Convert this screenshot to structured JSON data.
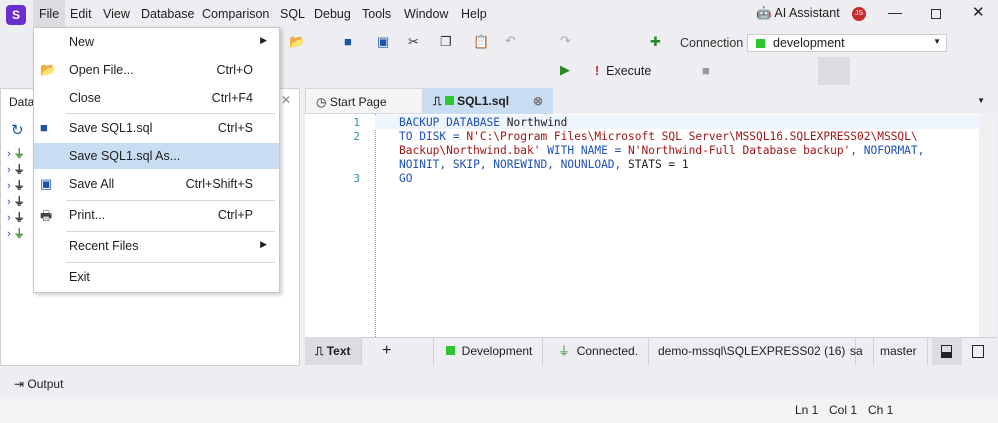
{
  "menubar": {
    "items": [
      "File",
      "Edit",
      "View",
      "Database",
      "Comparison",
      "SQL",
      "Debug",
      "Tools",
      "Window",
      "Help"
    ],
    "ai_assistant": "AI Assistant",
    "avatar": "JS"
  },
  "toolbar": {
    "connection_label": "Connection",
    "connection_value": "development",
    "execute": "Execute"
  },
  "file_menu": {
    "items": [
      {
        "label": "New",
        "shortcut": "",
        "icon": "",
        "submenu": true
      },
      {
        "label": "Open File...",
        "shortcut": "Ctrl+O",
        "icon": "open-folder-icon"
      },
      {
        "label": "Close",
        "shortcut": "Ctrl+F4",
        "icon": ""
      },
      {
        "label": "Save SQL1.sql",
        "shortcut": "Ctrl+S",
        "icon": "save-icon"
      },
      {
        "label": "Save SQL1.sql As...",
        "shortcut": "",
        "icon": "",
        "highlighted": true
      },
      {
        "label": "Save All",
        "shortcut": "Ctrl+Shift+S",
        "icon": "save-all-icon"
      },
      {
        "label": "Print...",
        "shortcut": "Ctrl+P",
        "icon": "printer-icon"
      },
      {
        "label": "Recent Files",
        "shortcut": "",
        "icon": "",
        "submenu": true
      },
      {
        "label": "Exit",
        "shortcut": "",
        "icon": ""
      }
    ]
  },
  "left_panel": {
    "title": "Data"
  },
  "tabs": [
    {
      "label": "Start Page"
    },
    {
      "label": "SQL1.sql",
      "active": true
    }
  ],
  "editor": {
    "lines": [
      {
        "num": "1",
        "tokens": [
          [
            "kw",
            "BACKUP DATABASE "
          ],
          [
            "",
            "Northwind"
          ]
        ]
      },
      {
        "num": "2",
        "tokens": [
          [
            "kw",
            "TO DISK = "
          ],
          [
            "str",
            "N'C:\\Program Files\\Microsoft SQL Server\\MSSQL16.SQLEXPRESS02\\MSSQL\\"
          ]
        ]
      },
      {
        "num": "",
        "tokens": [
          [
            "str",
            "Backup\\Northwind.bak'"
          ],
          [
            "kw",
            " WITH NAME = "
          ],
          [
            "str",
            "N'Northwind-Full Database backup'"
          ],
          [
            "kw",
            ", NOFORMAT,"
          ]
        ]
      },
      {
        "num": "",
        "tokens": [
          [
            "kw",
            "NOINIT, SKIP, NOREWIND, NOUNLOAD, "
          ],
          [
            "",
            "STATS = 1"
          ]
        ]
      },
      {
        "num": "3",
        "tokens": [
          [
            "kw",
            "GO"
          ]
        ]
      }
    ]
  },
  "status": {
    "mode": "Text",
    "env": "Development",
    "conn": "Connected.",
    "server": "demo-mssql\\SQLEXPRESS02 (16)",
    "user": "sa",
    "db": "master"
  },
  "output": {
    "label": "Output"
  },
  "position": {
    "ln": "Ln 1",
    "col": "Col 1",
    "ch": "Ch 1"
  },
  "colors": {
    "env": "#2ec62e",
    "accent": "#c9ddf2"
  }
}
